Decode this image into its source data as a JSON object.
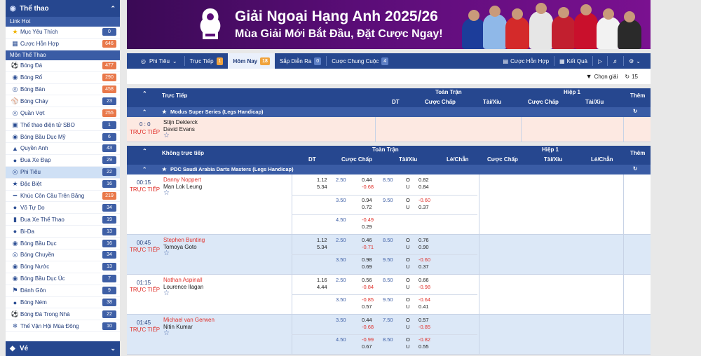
{
  "sidebar": {
    "title": "Thể thao",
    "sec_hot": "Link Hot",
    "hot_items": [
      {
        "label": "Mục Yêu Thích",
        "count": "0",
        "icon": "star-icon"
      },
      {
        "label": "Cược Hỗn Hợp",
        "count": "646",
        "icon": "parlay-icon"
      }
    ],
    "sec_sports": "Môn Thể Thao",
    "sports": [
      {
        "label": "Bóng Đá",
        "count": "477"
      },
      {
        "label": "Bóng Rổ",
        "count": "290"
      },
      {
        "label": "Bóng Bàn",
        "count": "458"
      },
      {
        "label": "Bóng Chày",
        "count": "23"
      },
      {
        "label": "Quần Vợt",
        "count": "255"
      },
      {
        "label": "Thể thao điện tử SBO",
        "count": "1"
      },
      {
        "label": "Bóng Bầu Dục Mỹ",
        "count": "6"
      },
      {
        "label": "Quyền Anh",
        "count": "43"
      },
      {
        "label": "Đua Xe Đạp",
        "count": "29"
      },
      {
        "label": "Phi Tiêu",
        "count": "22"
      },
      {
        "label": "Đặc Biệt",
        "count": "16"
      },
      {
        "label": "Khúc Côn Cầu Trên Băng",
        "count": "219"
      },
      {
        "label": "Võ Tự Do",
        "count": "34"
      },
      {
        "label": "Đua Xe Thể Thao",
        "count": "19"
      },
      {
        "label": "Bi-Da",
        "count": "13"
      },
      {
        "label": "Bóng Bầu Dục",
        "count": "16"
      },
      {
        "label": "Bóng Chuyền",
        "count": "34"
      },
      {
        "label": "Bóng Nước",
        "count": "13"
      },
      {
        "label": "Bóng Bầu Dục Úc",
        "count": "7"
      },
      {
        "label": "Đánh Gôn",
        "count": "9"
      },
      {
        "label": "Bóng Ném",
        "count": "38"
      },
      {
        "label": "Bóng Đá Trong Nhà",
        "count": "22"
      },
      {
        "label": "Thế Vận Hội Mùa Đông",
        "count": "10"
      }
    ],
    "bottom": "Vé"
  },
  "banner": {
    "title": "Giải Ngoại Hạng Anh 2025/26",
    "subtitle": "Mùa Giải Mới Bắt Đầu, Đặt Cược Ngay!"
  },
  "toolbar": {
    "sport": "Phi Tiêu",
    "tabs": [
      {
        "label": "Trực Tiếp",
        "count": "1"
      },
      {
        "label": "Hôm Nay",
        "count": "18"
      },
      {
        "label": "Sắp Diễn Ra",
        "count": "0"
      },
      {
        "label": "Cược Chung Cuộc",
        "count": "4"
      }
    ],
    "parlay": "Cược Hỗn Hợp",
    "results": "Kết Quả"
  },
  "filter": {
    "label": "Chọn giải",
    "count": "15"
  },
  "live": {
    "title": "Trực Tiếp",
    "full": "Toàn Trận",
    "half": "Hiệp 1",
    "more": "Thêm",
    "cols": [
      "DT",
      "Cược Chấp",
      "Tài/Xỉu",
      "Cược Chấp",
      "Tài/Xỉu"
    ],
    "league": "Modus Super Series (Legs Handicap)",
    "match": {
      "score": "0 : 0",
      "status": "TRỰC TIẾP",
      "home": "Stijn Deklerck",
      "away": "David Evans"
    }
  },
  "upcoming": {
    "title": "Không trực tiếp",
    "full": "Toàn Trận",
    "half": "Hiệp 1",
    "more": "Thêm",
    "cols": [
      "DT",
      "Cược Chấp",
      "Tài/Xỉu",
      "Lẻ/Chẵn",
      "Cược Chấp",
      "Tài/Xỉu",
      "Lẻ/Chẵn"
    ],
    "league": "PDC Saudi Arabia Darts Masters (Legs Handicap)",
    "matches": [
      {
        "time": "00:15",
        "status": "TRỰC TIẾP",
        "home": "Danny Noppert",
        "away": "Man Lok Leung",
        "lines": [
          {
            "dt1": "1.12",
            "dt2": "5.34",
            "hc": "2.50",
            "o1": "0.44",
            "o2": "-0.68",
            "tl": "8.50",
            "ou1": "O",
            "ou2": "U",
            "t1": "0.82",
            "t2": "0.84"
          },
          {
            "dt1": "",
            "dt2": "",
            "hc": "3.50",
            "o1": "0.94",
            "o2": "0.72",
            "tl": "9.50",
            "ou1": "O",
            "ou2": "U",
            "t1": "-0.60",
            "t2": "0.37"
          },
          {
            "dt1": "",
            "dt2": "",
            "hc": "4.50",
            "o1": "-0.49",
            "o2": "0.29",
            "tl": "",
            "ou1": "",
            "ou2": "",
            "t1": "",
            "t2": ""
          }
        ]
      },
      {
        "time": "00:45",
        "status": "TRỰC TIẾP",
        "home": "Stephen Bunting",
        "away": "Tomoya Goto",
        "lines": [
          {
            "dt1": "1.12",
            "dt2": "5.34",
            "hc": "2.50",
            "o1": "0.46",
            "o2": "-0.71",
            "tl": "8.50",
            "ou1": "O",
            "ou2": "U",
            "t1": "0.76",
            "t2": "0.90"
          },
          {
            "dt1": "",
            "dt2": "",
            "hc": "3.50",
            "o1": "0.98",
            "o2": "0.69",
            "tl": "9.50",
            "ou1": "O",
            "ou2": "U",
            "t1": "-0.60",
            "t2": "0.37"
          }
        ]
      },
      {
        "time": "01:15",
        "status": "TRỰC TIẾP",
        "home": "Nathan Aspinall",
        "away": "Lourence Ilagan",
        "lines": [
          {
            "dt1": "1.16",
            "dt2": "4.44",
            "hc": "2.50",
            "o1": "0.56",
            "o2": "-0.84",
            "tl": "8.50",
            "ou1": "O",
            "ou2": "U",
            "t1": "0.66",
            "t2": "-0.98"
          },
          {
            "dt1": "",
            "dt2": "",
            "hc": "3.50",
            "o1": "-0.85",
            "o2": "0.57",
            "tl": "9.50",
            "ou1": "O",
            "ou2": "U",
            "t1": "-0.64",
            "t2": "0.41"
          }
        ]
      },
      {
        "time": "01:45",
        "status": "TRỰC TIẾP",
        "home": "Michael van Gerwen",
        "away": "Nitin Kumar",
        "lines": [
          {
            "dt1": "",
            "dt2": "",
            "hc": "3.50",
            "o1": "0.44",
            "o2": "-0.68",
            "tl": "7.50",
            "ou1": "O",
            "ou2": "U",
            "t1": "0.57",
            "t2": "-0.85"
          },
          {
            "dt1": "",
            "dt2": "",
            "hc": "4.50",
            "o1": "-0.99",
            "o2": "0.67",
            "tl": "8.50",
            "ou1": "O",
            "ou2": "U",
            "t1": "-0.82",
            "t2": "0.55"
          }
        ]
      }
    ]
  }
}
